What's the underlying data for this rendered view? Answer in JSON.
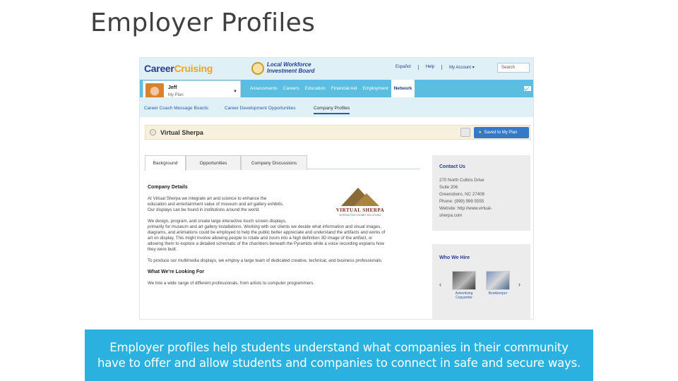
{
  "slide": {
    "title": "Employer Profiles",
    "caption_line1": "Employer profiles help students understand what companies in their community",
    "caption_line2": "have to offer and allow students and companies to connect in safe and secure ways."
  },
  "header": {
    "logo_part1": "Career",
    "logo_part2": "Cruising",
    "board_line1": "Local Workforce",
    "board_line2": "Investment Board",
    "links": [
      "Español",
      "Help",
      "My Account ▾"
    ],
    "search_label": "Search"
  },
  "user": {
    "name": "Jeff",
    "subtitle": "My Plan"
  },
  "nav": {
    "items": [
      "Assessments",
      "Careers",
      "Education",
      "Financial Aid",
      "Employment",
      "Network"
    ],
    "active": "Network"
  },
  "subnav": {
    "items": [
      "Career Coach Message Boards",
      "Career Development Opportunities",
      "Company Profiles"
    ]
  },
  "company": {
    "name": "Virtual Sherpa",
    "saved_label": "Saved to My Plan",
    "logo_text": "VIRTUAL SHERPA",
    "logo_sub": "INTERACTIVE EXHIBIT SOLUTIONS"
  },
  "tabs": [
    "Background",
    "Opportunities",
    "Company Discussions"
  ],
  "content": {
    "details_heading": "Company Details",
    "para1": [
      "At Virtual Sherpa we integrate art and science to enhance the",
      "education and entertainment value of museum and art gallery exhibits.",
      "Our displays can be found in institutions around the world."
    ],
    "para2": [
      "We design, program, and create large interactive touch screen displays,",
      "primarily for museum and art gallery installations. Working with our clients we decide what information and visual images,",
      "diagrams, and animations could be employed to help the public better appreciate and understand the artifacts and works of",
      "art on display. This might involve allowing people to rotate and zoom into a high definition 3D image of the artifact, or",
      "allowing them to explore a detailed schematic of the chambers beneath the Pyramids while a voice recording explains how",
      "they were built."
    ],
    "para3": "To produce our multimedia displays, we employ a large team of dedicated creative, technical, and business professionals.",
    "looking_heading": "What We're Looking For",
    "para4": "We hire a wide range of different professionals, from artists to computer programmers."
  },
  "contact": {
    "title": "Contact Us",
    "lines": [
      "270 North Collins Drive",
      "Suite 206",
      "Greensboro, NC 27408",
      "Phone: (999) 999 5555",
      "Website: http://www.virtual-",
      "sherpa.com"
    ]
  },
  "hire": {
    "title": "Who We Hire",
    "items": [
      {
        "caption": "Advertising Copywriter"
      },
      {
        "caption": "Bookkeeper"
      }
    ]
  }
}
